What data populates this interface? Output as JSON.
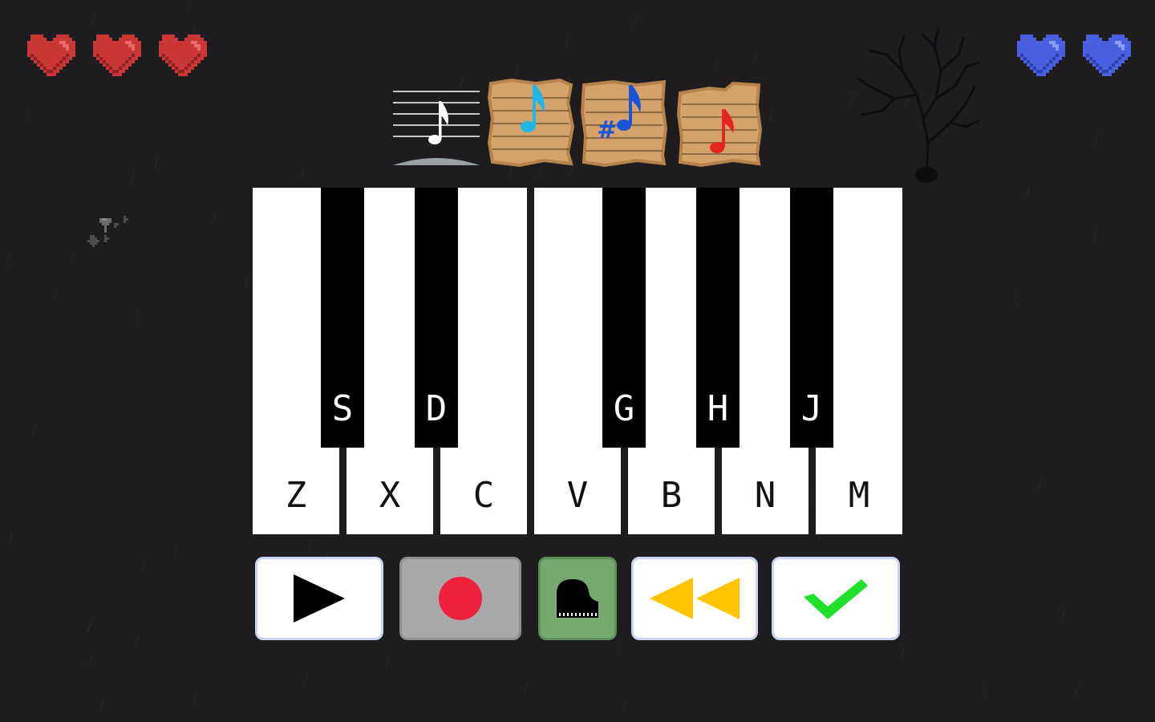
{
  "hud": {
    "player_hearts": 3,
    "player_heart_color": "#c93636",
    "rival_hearts": 2,
    "rival_heart_color": "#4a5fe0"
  },
  "sheets": [
    {
      "name": "white-note-staff",
      "note_color": "#ffffff",
      "style": "staff"
    },
    {
      "name": "blue-note-card",
      "note_color": "#1fb6e8",
      "style": "parchment"
    },
    {
      "name": "sharp-note-card",
      "note_color": "#1c54d8",
      "style": "parchment"
    },
    {
      "name": "red-note-card",
      "note_color": "#e52424",
      "style": "parchment"
    }
  ],
  "piano": {
    "white_keys": [
      "Z",
      "X",
      "C",
      "V",
      "B",
      "N",
      "M"
    ],
    "black_keys": [
      "S",
      "D",
      "G",
      "H",
      "J"
    ]
  },
  "controls": {
    "play_icon": "play-icon",
    "record_icon": "record-icon",
    "record_color": "#f0213c",
    "piano_icon": "grand-piano-icon",
    "rewind_icon": "rewind-icon",
    "rewind_color": "#ffc400",
    "confirm_icon": "checkmark-icon",
    "confirm_color": "#1fe02a"
  }
}
